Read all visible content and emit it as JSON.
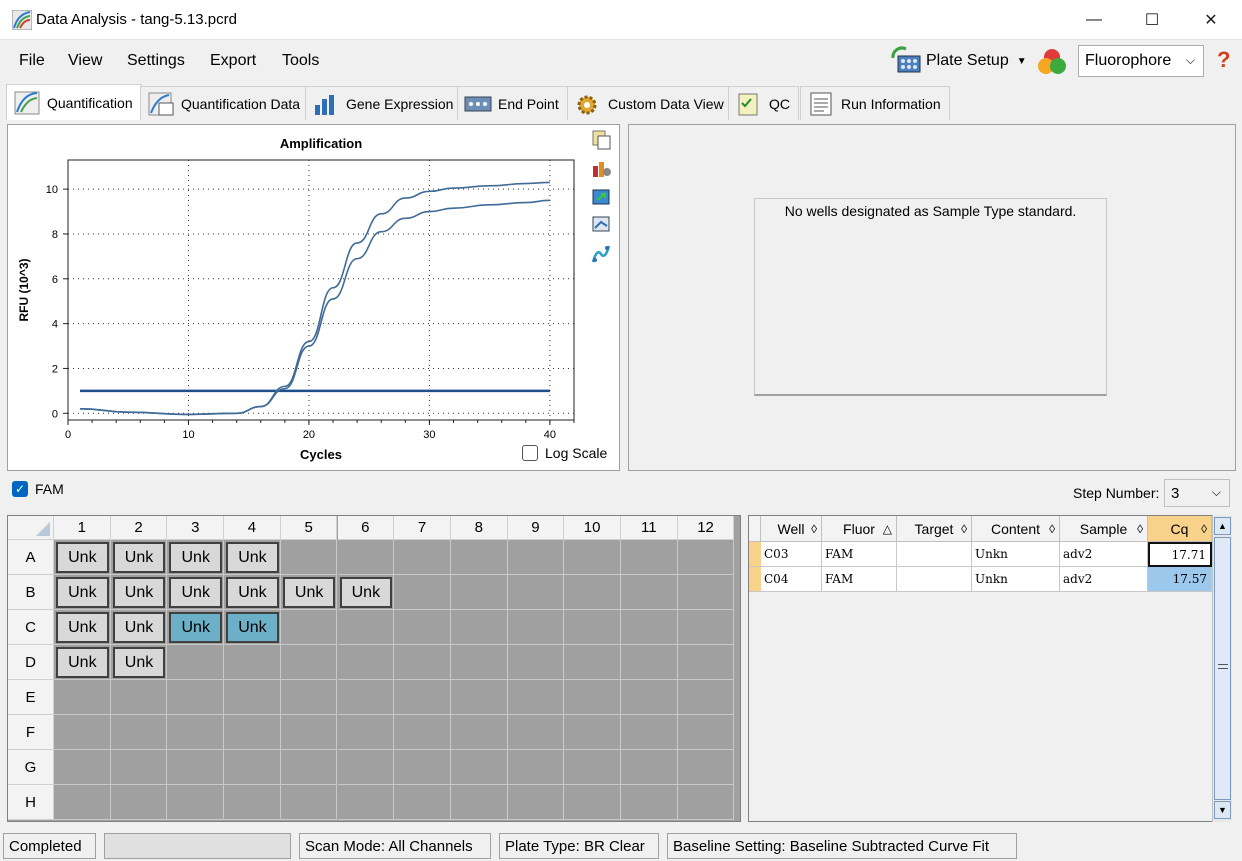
{
  "window": {
    "title": "Data Analysis - tang-5.13.pcrd",
    "minimize": "—",
    "maximize": "☐",
    "close": "✕"
  },
  "menu": {
    "file": "File",
    "view": "View",
    "settings": "Settings",
    "export": "Export",
    "tools": "Tools"
  },
  "toolbar": {
    "plate_setup": "Plate Setup",
    "fluorophore": "Fluorophore",
    "help": "?"
  },
  "tabs": [
    "Quantification",
    "Quantification Data",
    "Gene Expression",
    "End Point",
    "Custom Data View",
    "QC",
    "Run Information"
  ],
  "chart": {
    "log_scale_label": "Log Scale"
  },
  "chart_data": {
    "type": "line",
    "title": "Amplification",
    "xlabel": "Cycles",
    "ylabel": "RFU (10^3)",
    "xlim": [
      0,
      42
    ],
    "ylim": [
      -0.3,
      11.3
    ],
    "xticks": [
      0,
      10,
      20,
      30,
      40
    ],
    "yticks": [
      0,
      2,
      4,
      6,
      8,
      10
    ],
    "threshold": 1.0,
    "grid": true,
    "series": [
      {
        "x": [
          1,
          5,
          10,
          14,
          16,
          18,
          20,
          22,
          24,
          26,
          28,
          30,
          32,
          35,
          38,
          40
        ],
        "values": [
          0.2,
          0.05,
          -0.05,
          0.0,
          0.3,
          1.2,
          3.2,
          5.6,
          7.6,
          8.9,
          9.6,
          9.9,
          10.05,
          10.15,
          10.25,
          10.3
        ]
      },
      {
        "x": [
          1,
          5,
          10,
          14,
          16,
          18,
          20,
          22,
          24,
          26,
          28,
          30,
          32,
          35,
          38,
          40
        ],
        "values": [
          0.2,
          0.05,
          -0.05,
          0.0,
          0.3,
          1.1,
          3.0,
          5.1,
          6.9,
          8.1,
          8.7,
          9.0,
          9.15,
          9.3,
          9.4,
          9.5
        ]
      }
    ]
  },
  "std_panel": {
    "message": "No wells designated as Sample Type standard."
  },
  "fam": {
    "label": "FAM",
    "checked": true
  },
  "step": {
    "label": "Step Number:",
    "value": "3"
  },
  "plate": {
    "columns": [
      "1",
      "2",
      "3",
      "4",
      "5",
      "6",
      "7",
      "8",
      "9",
      "10",
      "11",
      "12"
    ],
    "rows": [
      "A",
      "B",
      "C",
      "D",
      "E",
      "F",
      "G",
      "H"
    ],
    "wells": [
      {
        "row": 0,
        "col": 0,
        "label": "Unk"
      },
      {
        "row": 0,
        "col": 1,
        "label": "Unk"
      },
      {
        "row": 0,
        "col": 2,
        "label": "Unk"
      },
      {
        "row": 0,
        "col": 3,
        "label": "Unk"
      },
      {
        "row": 1,
        "col": 0,
        "label": "Unk"
      },
      {
        "row": 1,
        "col": 1,
        "label": "Unk"
      },
      {
        "row": 1,
        "col": 2,
        "label": "Unk"
      },
      {
        "row": 1,
        "col": 3,
        "label": "Unk"
      },
      {
        "row": 1,
        "col": 4,
        "label": "Unk"
      },
      {
        "row": 1,
        "col": 5,
        "label": "Unk"
      },
      {
        "row": 2,
        "col": 0,
        "label": "Unk"
      },
      {
        "row": 2,
        "col": 1,
        "label": "Unk"
      },
      {
        "row": 2,
        "col": 2,
        "label": "Unk",
        "selected": true
      },
      {
        "row": 2,
        "col": 3,
        "label": "Unk",
        "selected": true
      },
      {
        "row": 3,
        "col": 0,
        "label": "Unk"
      },
      {
        "row": 3,
        "col": 1,
        "label": "Unk"
      }
    ]
  },
  "table": {
    "headers": [
      "Well",
      "Fluor",
      "Target",
      "Content",
      "Sample",
      "Cq"
    ],
    "sort_marks": [
      "◊",
      "◊",
      "◊",
      "◊",
      "◊",
      "◊"
    ],
    "fluor_sort": "△",
    "rows": [
      [
        "C03",
        "FAM",
        "",
        "Unkn",
        "adv2",
        "17.71"
      ],
      [
        "C04",
        "FAM",
        "",
        "Unkn",
        "adv2",
        "17.57"
      ]
    ]
  },
  "status": {
    "state": "Completed",
    "scan_mode": "Scan Mode: All Channels",
    "plate_type": "Plate Type: BR Clear",
    "baseline": "Baseline Setting: Baseline Subtracted Curve Fit"
  }
}
